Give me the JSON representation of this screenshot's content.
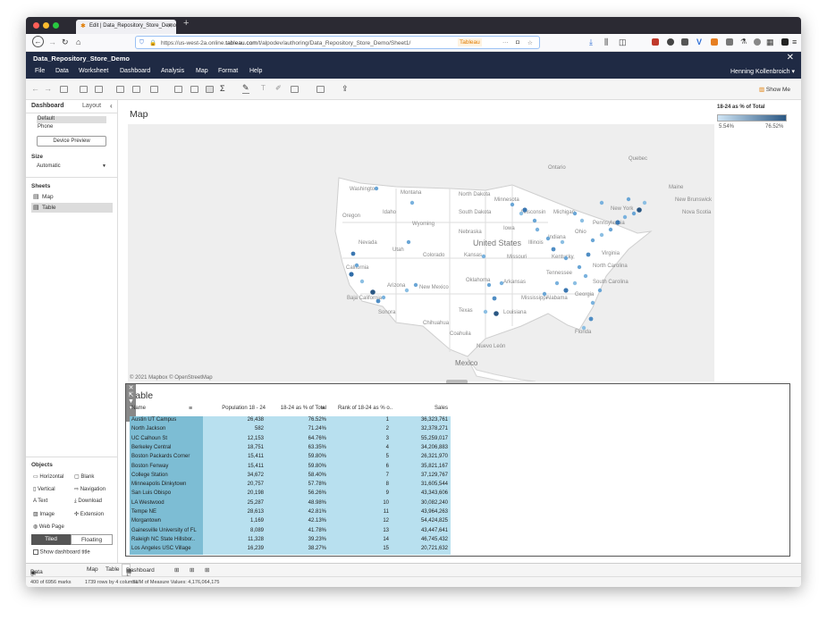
{
  "browser": {
    "tab_title": "Edit | Data_Repository_Store_Demo",
    "url_prefix": "https://us-west-2a.online.",
    "url_domain": "tableau.com",
    "url_suffix": "/t/alpodev/authoring/Data_Repository_Store_Demo/Sheet1/",
    "tableau_badge": "Tableau"
  },
  "app": {
    "workbook_title": "Data_Repository_Store_Demo",
    "menu": [
      "File",
      "Data",
      "Worksheet",
      "Dashboard",
      "Analysis",
      "Map",
      "Format",
      "Help"
    ],
    "user": "Henning Kollenbroich ▾",
    "show_me": "Show Me"
  },
  "left_panel": {
    "tab_dashboard": "Dashboard",
    "tab_layout": "Layout",
    "device_default": "Default",
    "device_phone": "Phone",
    "device_preview": "Device Preview",
    "size_label": "Size",
    "size_value": "Automatic",
    "sheets_label": "Sheets",
    "sheets": [
      "Map",
      "Table"
    ],
    "objects_label": "Objects",
    "objects": [
      "Horizontal",
      "Blank",
      "Vertical",
      "Navigation",
      "Text",
      "Download",
      "Image",
      "Extension",
      "Web Page"
    ],
    "tiled": "Tiled",
    "floating": "Floating",
    "show_title": "Show dashboard title"
  },
  "map": {
    "title": "Map",
    "attribution": "© 2021 Mapbox © OpenStreetMap",
    "country_label": "United States",
    "mexico_label": "Mexico",
    "state_labels": [
      "Washington",
      "Montana",
      "North Dakota",
      "Minnesota",
      "Oregon",
      "Idaho",
      "South Dakota",
      "Wisconsin",
      "Wyoming",
      "Nebraska",
      "Iowa",
      "Nevada",
      "Utah",
      "Colorado",
      "Kansas",
      "Missouri",
      "California",
      "Arizona",
      "New Mexico",
      "Oklahoma",
      "Arkansas",
      "Texas",
      "Louisiana",
      "Kentucky",
      "Illinois",
      "Indiana",
      "Ohio",
      "Michigan",
      "Pennsylvania",
      "New York",
      "Virginia",
      "Tennessee",
      "Alabama",
      "Georgia",
      "South Carolina",
      "North Carolina",
      "Mississippi",
      "Florida",
      "Maine",
      "Quebec",
      "Ontario",
      "Nova Scotia",
      "New Brunswick",
      "Chihuahua",
      "Coahuila",
      "Nuevo León",
      "Sonora",
      "Baja California"
    ],
    "legend_title": "18-24 as % of Total",
    "legend_min": "5.54%",
    "legend_max": "76.52%",
    "accent": "#2a5783"
  },
  "table": {
    "title": "Table",
    "headers": [
      "Name",
      "Population 18 - 24",
      "18-24 as % of Total",
      "Rank of 18-24 as % o..",
      "Sales"
    ],
    "rows": [
      {
        "name": "Austin UT Campus",
        "pop": "26,438",
        "pct": "76.52%",
        "rank": "1",
        "sales": "36,323,761"
      },
      {
        "name": "North Jackson",
        "pop": "582",
        "pct": "71.24%",
        "rank": "2",
        "sales": "32,378,271"
      },
      {
        "name": "UC Calhoun St",
        "pop": "12,153",
        "pct": "64.76%",
        "rank": "3",
        "sales": "55,259,017"
      },
      {
        "name": "Berkeley Central",
        "pop": "18,751",
        "pct": "63.35%",
        "rank": "4",
        "sales": "34,206,883"
      },
      {
        "name": "Boston Packards Corner",
        "pop": "15,411",
        "pct": "59.80%",
        "rank": "5",
        "sales": "26,321,970"
      },
      {
        "name": "Boston Fenway",
        "pop": "15,411",
        "pct": "59.80%",
        "rank": "6",
        "sales": "35,821,167"
      },
      {
        "name": "College Station",
        "pop": "34,672",
        "pct": "58.40%",
        "rank": "7",
        "sales": "37,129,767"
      },
      {
        "name": "Minneapolis Dinkytown",
        "pop": "20,757",
        "pct": "57.78%",
        "rank": "8",
        "sales": "31,605,544"
      },
      {
        "name": "San Luis Obispo",
        "pop": "20,198",
        "pct": "56.26%",
        "rank": "9",
        "sales": "43,343,606"
      },
      {
        "name": "LA Westwood",
        "pop": "25,287",
        "pct": "48.98%",
        "rank": "10",
        "sales": "30,082,240"
      },
      {
        "name": "Tempe NE",
        "pop": "28,613",
        "pct": "42.81%",
        "rank": "11",
        "sales": "43,964,263"
      },
      {
        "name": "Morgantown",
        "pop": "1,169",
        "pct": "42.13%",
        "rank": "12",
        "sales": "54,424,825"
      },
      {
        "name": "Gainesville University of FL",
        "pop": "8,089",
        "pct": "41.78%",
        "rank": "13",
        "sales": "43,447,641"
      },
      {
        "name": "Raleigh NC State Hillsbor..",
        "pop": "11,328",
        "pct": "39.23%",
        "rank": "14",
        "sales": "46,745,432"
      },
      {
        "name": "Los Angeles USC Village",
        "pop": "16,239",
        "pct": "38.27%",
        "rank": "15",
        "sales": "20,721,632"
      }
    ]
  },
  "statusbar": {
    "data_source": "Data Source",
    "tab_map": "Map",
    "tab_table": "Table",
    "tab_dashboard": "Dashboard 1"
  },
  "bottom": {
    "marks": "400 of 6956 marks",
    "rows": "1739 rows by 4 columns",
    "sum": "SUM of Measure Values: 4,176,064,175"
  }
}
